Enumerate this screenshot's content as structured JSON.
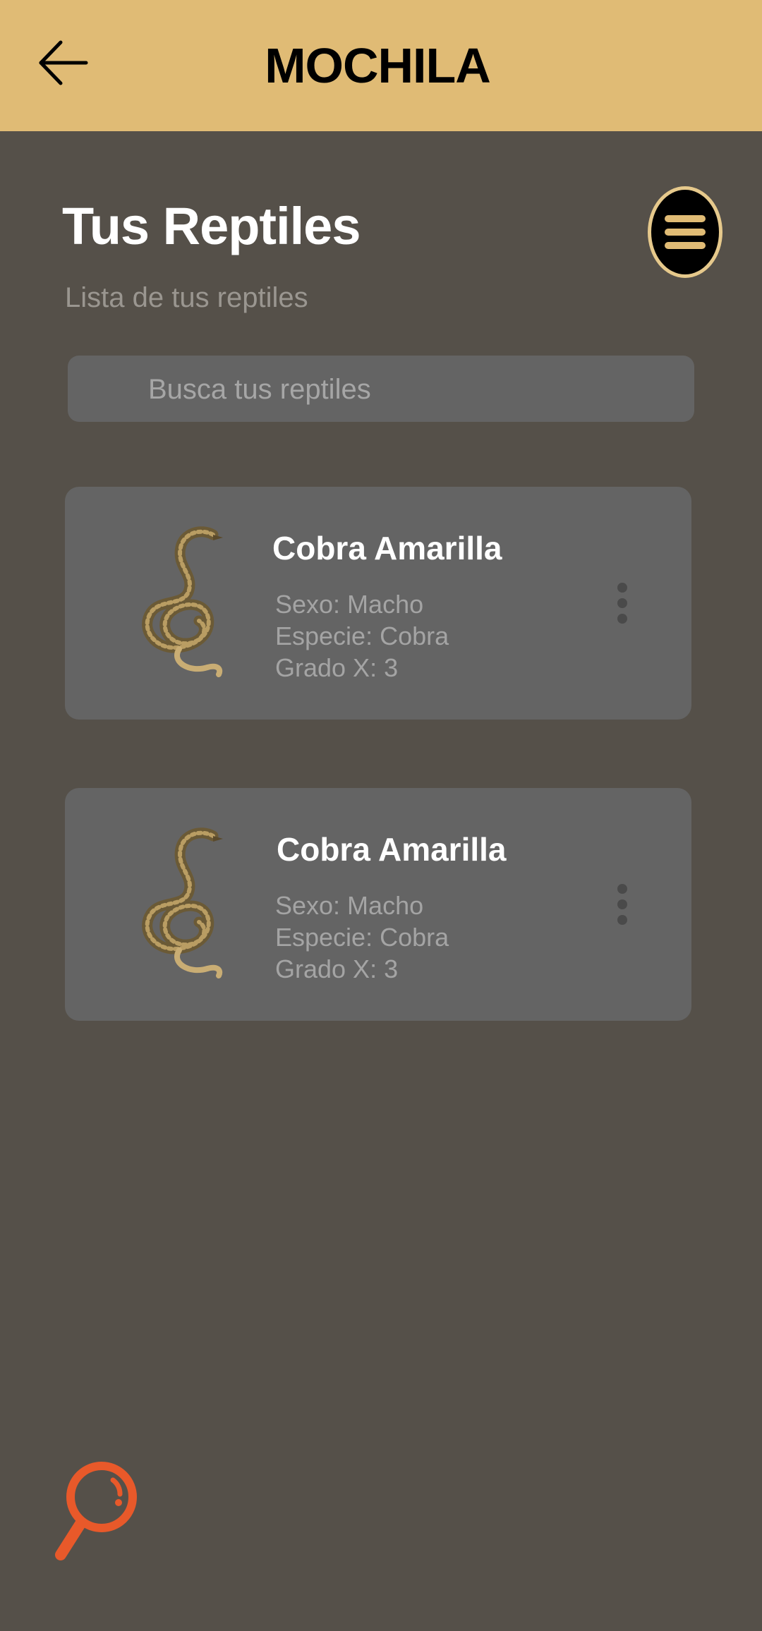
{
  "header": {
    "title": "MOCHILA",
    "back_icon": "arrow-left-icon"
  },
  "section": {
    "title": "Tus Reptiles",
    "subtitle": "Lista de tus reptiles",
    "menu_icon": "hamburger-menu-icon"
  },
  "search": {
    "placeholder": "Busca tus reptiles",
    "value": ""
  },
  "reptiles": [
    {
      "name": "Cobra Amarilla",
      "sexo": "Sexo: Macho",
      "especie": "Especie: Cobra",
      "grado": "Grado X: 3",
      "image_icon": "snake-image",
      "more_icon": "more-vertical-icon"
    },
    {
      "name": "Cobra Amarilla",
      "sexo": "Sexo: Macho",
      "especie": "Especie: Cobra",
      "grado": "Grado X: 3",
      "image_icon": "snake-image",
      "more_icon": "more-vertical-icon"
    }
  ],
  "fab": {
    "icon": "magnifier-icon"
  },
  "colors": {
    "header_bg": "#e0bb75",
    "page_bg": "#555049",
    "card_bg": "#646464",
    "accent": "#e8592a"
  }
}
